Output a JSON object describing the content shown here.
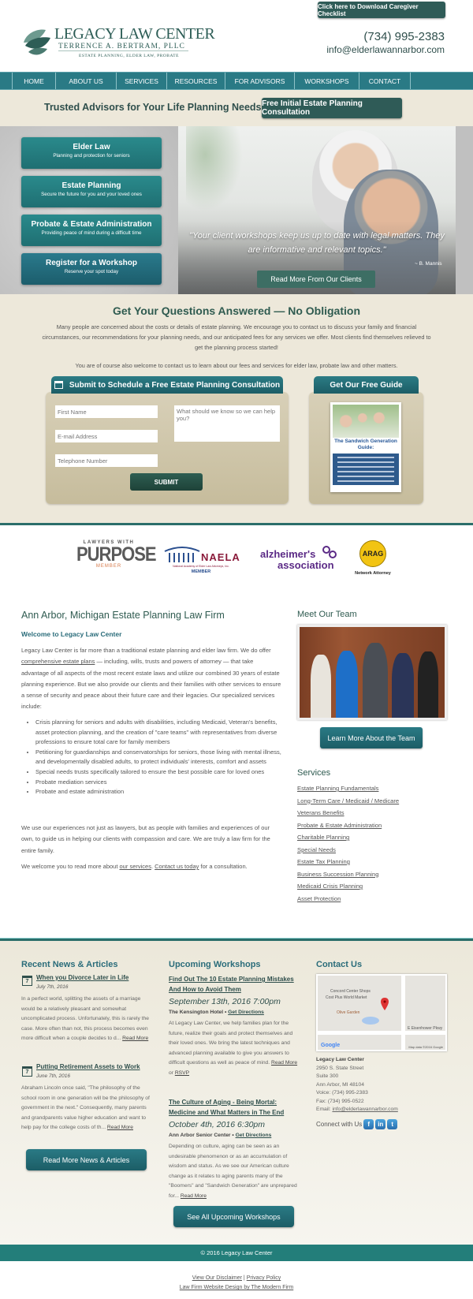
{
  "header": {
    "checklist_button": "Click here to Download Caregiver Checklist",
    "logo": {
      "line1": "LEGACY LAW CENTER",
      "line2": "TERRENCE A. BERTRAM, PLLC",
      "line3": "ESTATE PLANNING, ELDER LAW, PROBATE"
    },
    "phone": "(734) 995-2383",
    "email": "info@elderlawannarbor.com"
  },
  "nav": {
    "items": [
      "HOME",
      "ABOUT US",
      "SERVICES",
      "RESOURCES",
      "FOR ADVISORS",
      "WORKSHOPS",
      "CONTACT"
    ]
  },
  "trusted": {
    "title": "Trusted Advisors for Your Life Planning Needs",
    "button": "Free Initial Estate Planning Consultation"
  },
  "hero": {
    "services": [
      {
        "title": "Elder Law",
        "subtitle": "Planning and protection for seniors"
      },
      {
        "title": "Estate Planning",
        "subtitle": "Secure the future for you and your loved ones"
      },
      {
        "title": "Probate & Estate Administration",
        "subtitle": "Providing peace of mind during a difficult time"
      },
      {
        "title": "Register for a Workshop",
        "subtitle": "Reserve your spot today"
      }
    ],
    "quote": "\"Your client workshops keep us up to date with legal matters. They are informative and relevant topics.\"",
    "quote_author": "~ B. Mannis",
    "clients_button": "Read More From Our Clients"
  },
  "questions": {
    "title": "Get Your Questions Answered — No Obligation",
    "p1": "Many people are concerned about the costs or details of estate planning. We encourage you to contact us to discuss your family and financial circumstances, our recommendations for your planning needs, and our anticipated fees for any services we offer. Most clients find themselves relieved to get the planning process started!",
    "p2": "You are of course also welcome to contact us to learn about our fees and services for elder law, probate law and other matters.",
    "form_tab": "Submit to Schedule a Free Estate Planning Consultation",
    "fields": {
      "first_name": "First Name",
      "email": "E-mail Address",
      "phone": "Telephone Number",
      "message": "What should we know so we can help you?"
    },
    "submit": "SUBMIT",
    "guide_tab": "Get Our Free Guide",
    "guide_title": "The Sandwich Generation Guide:"
  },
  "affiliations": [
    {
      "name": "Lawyers With Purpose",
      "top": "LAWYERS WITH",
      "main": "PURPOSE",
      "sub": "MEMBER"
    },
    {
      "name": "NAELA",
      "main": "NAELA",
      "small": "National Academy of Elder Law Attorneys, Inc.",
      "sub": "MEMBER"
    },
    {
      "name": "Alzheimer's Association",
      "line1": "alzheimer's",
      "line2": "association"
    },
    {
      "name": "ARAG",
      "main": "ARAG",
      "sub": "Network Attorney"
    }
  ],
  "main": {
    "title": "Ann Arbor, Michigan Estate Planning Law Firm",
    "welcome": "Welcome to Legacy Law Center",
    "intro_pre": "Legacy Law Center is far more than a traditional estate planning and elder law firm. We do offer ",
    "intro_link": "comprehensive estate plans",
    "intro_post": " — including, wills, trusts and powers of attorney — that take advantage of all aspects of the most recent estate laws and utilize our combined 30 years of estate planning experience. But we also provide our clients and their families with other services to ensure a sense of security and peace about their future care and their legacies. Our specialized services include:",
    "bullets": [
      "Crisis planning for seniors and adults with disabilities, including Medicaid, Veteran's benefits, asset protection planning, and the creation of \"care teams\" with representatives from diverse professions to ensure total care for family members",
      "Petitioning for guardianships and conservatorships for seniors, those living with mental illness, and developmentally disabled adults, to protect individuals' interests, comfort and assets",
      "Special needs trusts specifically tailored to ensure the best possible care for loved ones",
      "Probate mediation services",
      "Probate and estate administration"
    ],
    "p2": "We use our experiences not just as lawyers, but as people with families and experiences of our own, to guide us in helping our clients with compassion and care. We are truly a law firm for the entire family.",
    "p3_pre": "We welcome you to read more about ",
    "p3_link1": "our services",
    "p3_mid": ". ",
    "p3_link2": "Contact us today",
    "p3_post": " for a consultation."
  },
  "sidebar": {
    "team_title": "Meet Our Team",
    "team_button": "Learn More About the Team",
    "services_title": "Services",
    "services": [
      "Estate Planning Fundamentals",
      "Long-Term Care / Medicaid / Medicare",
      "Veterans Benefits",
      "Probate & Estate Administration",
      "Charitable Planning",
      "Special Needs",
      "Estate Tax Planning",
      "Business Succession Planning",
      "Medicaid Crisis Planning",
      "Asset Protection"
    ]
  },
  "news": {
    "title": "Recent News & Articles",
    "articles": [
      {
        "day": "7",
        "title": "When you Divorce Later in Life",
        "date": "July 7th, 2016",
        "excerpt": "In a perfect world, splitting the assets of a marriage would be a relatively pleasant and somewhat uncomplicated process. Unfortunately, this is rarely the case. More often than not, this process becomes even more difficult when a couple decides to d... ",
        "more": "Read More"
      },
      {
        "day": "7",
        "title": "Putting Retirement Assets to Work",
        "date": "June 7th, 2016",
        "excerpt": "Abraham Lincoln once said, \"The philosophy of the school room in one generation will be the philosophy of government in the next.\" Consequently, many parents and grandparents value higher education and want to help pay for the college costs of th... ",
        "more": "Read More"
      }
    ],
    "button": "Read More News & Articles"
  },
  "workshops": {
    "title": "Upcoming Workshops",
    "items": [
      {
        "title": "Find Out The 10 Estate Planning Mistakes And How to Avoid Them",
        "date": "September 13th, 2016 7:00pm",
        "location": "The Kensington Hotel",
        "directions": "Get Directions",
        "excerpt": "At Legacy Law Center, we help families plan for the future, realize their goals and protect themselves and their loved ones. We bring the latest techniques and advanced planning available to give you answers to difficult questions as well as peace of mind. ",
        "more": "Read More",
        "or": " or ",
        "rsvp": "RSVP"
      },
      {
        "title": "The Culture of Aging - Being Mortal: Medicine and What Matters in The End",
        "date": "October 4th, 2016 6:30pm",
        "location": "Ann Arbor Senior Center",
        "directions": "Get Directions",
        "excerpt": "Depending on culture, aging can be seen as an undesirable phenomenon or as an accumulation of wisdom and status. As we see our American culture change as it relates to aging parents many of the \"Boomers\" and \"Sandwich Generation\" are unprepared for... ",
        "more": "Read More"
      }
    ],
    "button": "See All Upcoming Workshops"
  },
  "contact": {
    "title": "Contact Us",
    "map": {
      "labels": [
        "Concord Center Shops",
        "Cost Plus World Market",
        "Olive Garden",
        "E Eisenhower Pkwy"
      ],
      "google": "Google",
      "attribution": "Map data ©2016 Google"
    },
    "name": "Legacy Law Center",
    "address1": "2950 S. State Street",
    "address2": "Suite 300",
    "city": "Ann Arbor, MI 48104",
    "voice": "Voice: (734) 995-2383",
    "fax": "Fax: (734) 995-0522",
    "email_label": "Email: ",
    "email": "info@elderlawannarbor.com",
    "connect": "Connect with Us",
    "social": [
      {
        "icon": "facebook-icon",
        "glyph": "f"
      },
      {
        "icon": "linkedin-icon",
        "glyph": "in"
      },
      {
        "icon": "twitter-icon",
        "glyph": "t"
      }
    ]
  },
  "footer": {
    "copyright": "© 2016 Legacy Law Center",
    "disclaimer": "View Our Disclaimer",
    "sep": " | ",
    "privacy": "Privacy Policy",
    "design": "Law Firm Website Design by The Modern Firm"
  },
  "colors": {
    "teal": "#2a7a85",
    "dark_green": "#2f5b57",
    "beige": "#ede8da",
    "heading": "#2f5b50"
  }
}
